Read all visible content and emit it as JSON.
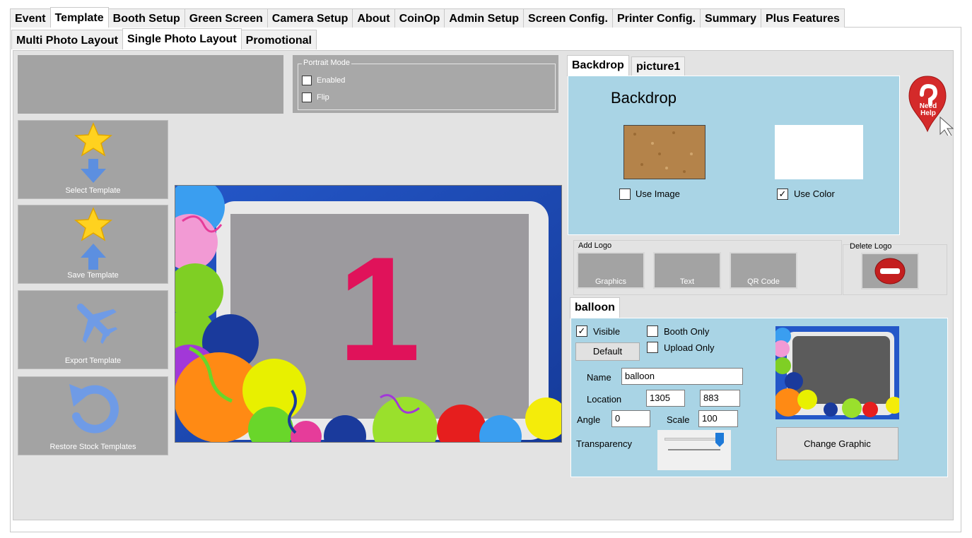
{
  "top_tabs": [
    "Event",
    "Template",
    "Booth Setup",
    "Green Screen",
    "Camera Setup",
    "About",
    "CoinOp",
    "Admin Setup",
    "Screen Config.",
    "Printer Config.",
    "Summary",
    "Plus Features"
  ],
  "sub_tabs": [
    "Multi Photo Layout",
    "Single Photo Layout",
    "Promotional"
  ],
  "portrait_mode": {
    "legend": "Portrait Mode",
    "enabled_label": "Enabled",
    "enabled_checked": false,
    "flip_label": "Flip",
    "flip_checked": false
  },
  "left_buttons": {
    "select": "Select Template",
    "save": "Save Template",
    "export": "Export Template",
    "restore": "Restore Stock Templates"
  },
  "preview": {
    "number": "1",
    "number_color": "#e0125a"
  },
  "backdrop_tabs": [
    "Backdrop",
    "picture1"
  ],
  "backdrop": {
    "title": "Backdrop",
    "use_image_label": "Use Image",
    "use_image_checked": false,
    "use_color_label": "Use Color",
    "use_color_checked": true,
    "color_swatch": "#ffffff"
  },
  "help": {
    "line1": "Need",
    "line2": "Help",
    "color": "#d42a2a"
  },
  "logo": {
    "add_label": "Add Logo",
    "delete_label": "Delete Logo",
    "graphics": "Graphics",
    "text": "Text",
    "qr": "QR Code"
  },
  "layer_tab": "balloon",
  "layer": {
    "visible_label": "Visible",
    "visible_checked": true,
    "booth_only_label": "Booth Only",
    "booth_only_checked": false,
    "upload_only_label": "Upload Only",
    "upload_only_checked": false,
    "default_button": "Default",
    "name_label": "Name",
    "name_value": "balloon",
    "location_label": "Location",
    "location_x": "1305",
    "location_y": "883",
    "angle_label": "Angle",
    "angle_value": "0",
    "scale_label": "Scale",
    "scale_value": "100",
    "transparency_label": "Transparency",
    "transparency_level": 1.0,
    "change_graphic_button": "Change Graphic"
  }
}
